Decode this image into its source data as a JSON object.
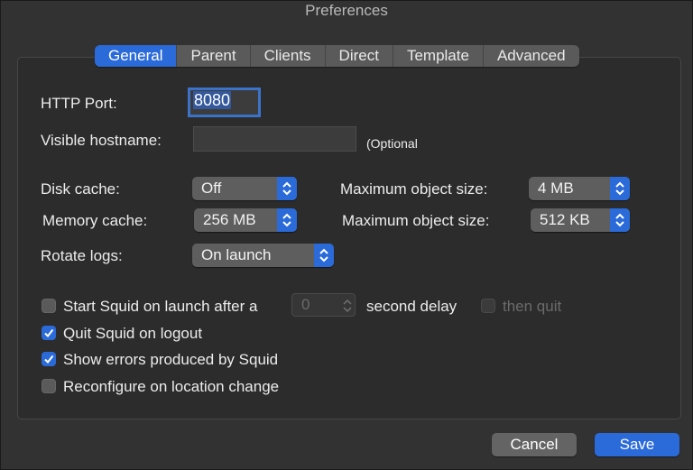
{
  "window": {
    "title": "Preferences"
  },
  "tabs": [
    {
      "label": "General",
      "active": true
    },
    {
      "label": "Parent"
    },
    {
      "label": "Clients"
    },
    {
      "label": "Direct"
    },
    {
      "label": "Template"
    },
    {
      "label": "Advanced"
    }
  ],
  "general": {
    "http_port_label": "HTTP Port:",
    "http_port_value": "8080",
    "visible_hostname_label": "Visible hostname:",
    "visible_hostname_value": "",
    "optional_hint": "(Optional",
    "disk_cache_label": "Disk cache:",
    "disk_cache_value": "Off",
    "disk_max_object_label": "Maximum object size:",
    "disk_max_object_value": "4 MB",
    "memory_cache_label": "Memory cache:",
    "memory_cache_value": "256 MB",
    "memory_max_object_label": "Maximum object size:",
    "memory_max_object_value": "512 KB",
    "rotate_logs_label": "Rotate logs:",
    "rotate_logs_value": "On launch"
  },
  "options": {
    "start_on_launch_label": "Start Squid on launch after a",
    "start_on_launch_checked": false,
    "delay_value": "0",
    "delay_suffix": "second delay",
    "then_quit_label": "then quit",
    "then_quit_checked": false,
    "quit_on_logout_label": "Quit Squid on logout",
    "quit_on_logout_checked": true,
    "show_errors_label": "Show errors produced by Squid",
    "show_errors_checked": true,
    "reconfigure_label": "Reconfigure on location change",
    "reconfigure_checked": false
  },
  "buttons": {
    "cancel": "Cancel",
    "save": "Save"
  },
  "colors": {
    "accent": "#2a6ad9",
    "window_bg": "#323232",
    "panel_bg": "#2c2c2c"
  }
}
